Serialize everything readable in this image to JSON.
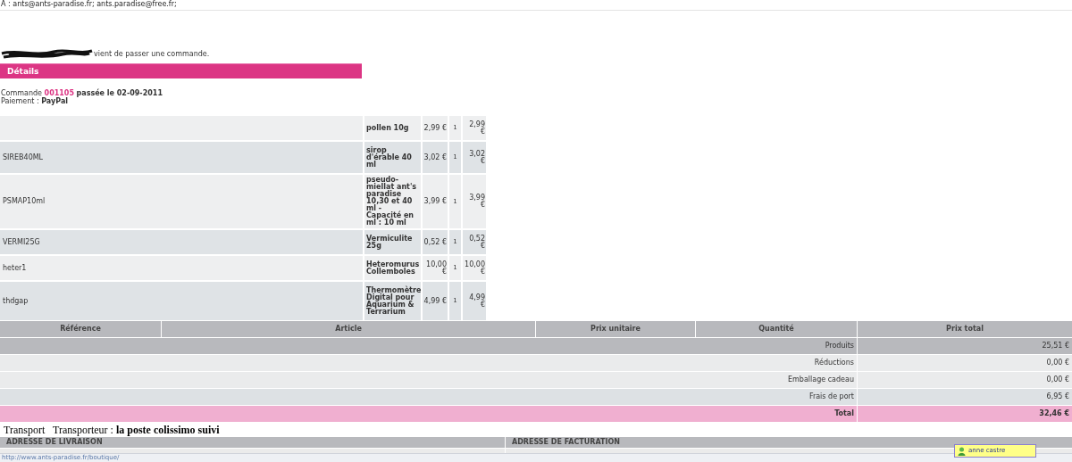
{
  "recipients": {
    "label": "A :",
    "value": "ants@ants-paradise.fr; ants.paradise@free.fr;"
  },
  "intro": "vient de passer une commande.",
  "section_title": "Détails",
  "order": {
    "label": "Commande",
    "number": "001105",
    "date_text": "passée le 02-09-2011",
    "payment_label": "Paiement :",
    "payment": "PayPal"
  },
  "products": [
    {
      "article": "pollen 10g",
      "unit_price": "2,99 €",
      "quantity": "1",
      "total": "2,99 €"
    },
    {
      "reference": "SIREB40ML",
      "article": "sirop d'érable 40 ml",
      "unit_price": "3,02 €",
      "quantity": "1",
      "total": "3,02 €"
    },
    {
      "reference": "PSMAP10ml",
      "article": "pseudo-miellat ant's paradise 10,30 et 40 ml - Capacité en ml : 10 ml",
      "unit_price": "3,99 €",
      "quantity": "1",
      "total": "3,99 €"
    },
    {
      "reference": "VERMI25G",
      "article": "Vermiculite 25g",
      "unit_price": "0,52 €",
      "quantity": "1",
      "total": "0,52 €"
    },
    {
      "reference": "heter1",
      "article": "Heteromurus Collemboles",
      "unit_price": "10,00 €",
      "quantity": "1",
      "total": "10,00 €"
    },
    {
      "reference": "thdgap",
      "article": "Thermomètre Digital pour Aquarium & Terrarium",
      "unit_price": "4,99 €",
      "quantity": "1",
      "total": "4,99 €"
    }
  ],
  "table": {
    "columns": [
      "Référence",
      "Article",
      "Prix unitaire",
      "Quantité",
      "Prix total"
    ],
    "summary": [
      {
        "kind": "subtotal",
        "label": "Produits",
        "value": "25,51 €"
      },
      {
        "kind": "plain",
        "label": "Réductions",
        "value": "0,00 €"
      },
      {
        "kind": "plain",
        "label": "Emballage cadeau",
        "value": "0,00 €"
      },
      {
        "kind": "shipping",
        "label": "Frais de port",
        "value": "6,95 €"
      },
      {
        "kind": "total",
        "label": "Total",
        "value": "32,46 €"
      }
    ]
  },
  "transport": {
    "label": "Transport",
    "carrier_label": "Transporteur :",
    "carrier": "la poste colissimo suivi"
  },
  "addresses": [
    "ADRESSE DE LIVRAISON",
    "ADRESSE DE FACTURATION"
  ],
  "status_bar": "http://www.ants-paradise.fr/boutique/",
  "tooltip": {
    "name": "anne castre"
  }
}
